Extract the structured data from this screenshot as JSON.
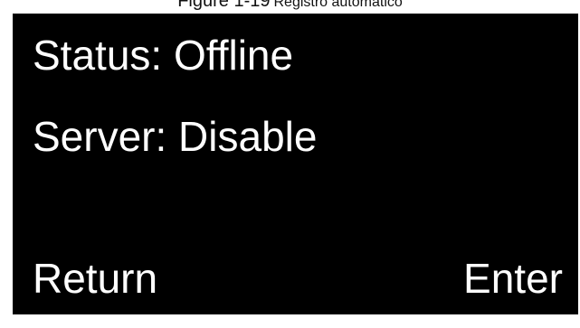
{
  "caption": {
    "figure_number": "Figure 1-19",
    "figure_title": "Registro automático"
  },
  "screen": {
    "status_text": "Status: Offline",
    "server_text": "Server: Disable",
    "return_label": "Return",
    "enter_label": "Enter"
  },
  "colors": {
    "screen_background": "#000000",
    "text": "#ffffff"
  }
}
